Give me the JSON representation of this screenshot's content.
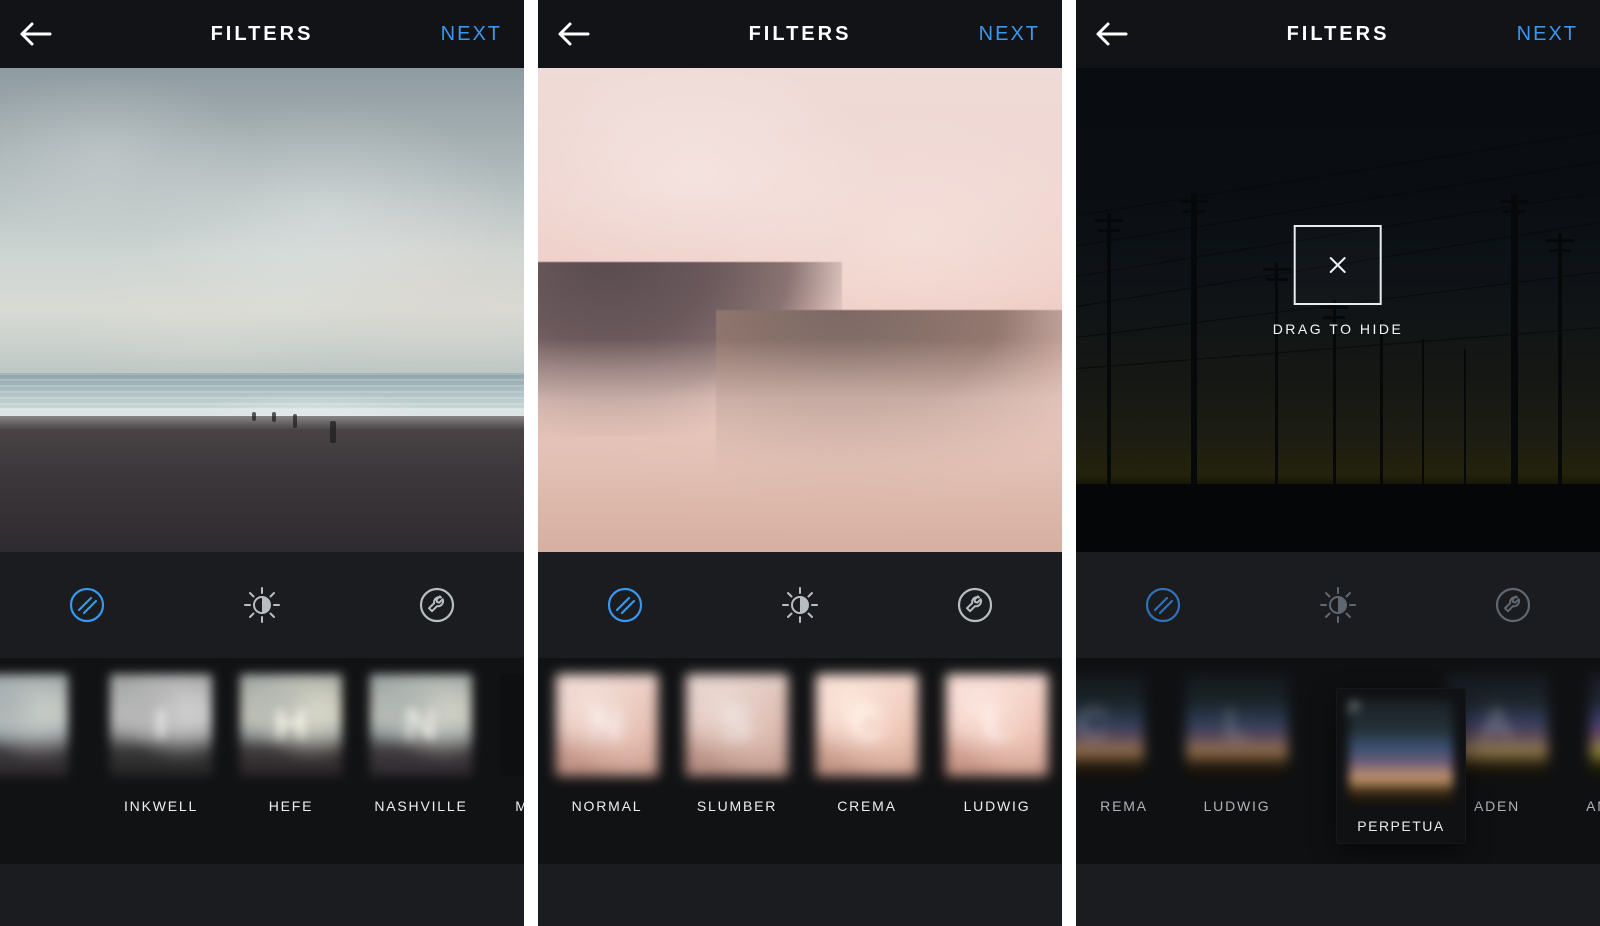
{
  "colors": {
    "accent": "#3897f0",
    "bg": "#1a1c1f"
  },
  "header": {
    "title": "FILTERS",
    "next": "NEXT"
  },
  "screens": {
    "s1": {
      "filters": [
        {
          "letter": "I",
          "label": "INKWELL"
        },
        {
          "letter": "H",
          "label": "HEFE"
        },
        {
          "letter": "N",
          "label": "NASHVILLE"
        },
        {
          "letter": "",
          "label": "MANAGE",
          "manage": true
        }
      ]
    },
    "s2": {
      "filters": [
        {
          "letter": "N",
          "label": "NORMAL"
        },
        {
          "letter": "S",
          "label": "SLUMBER"
        },
        {
          "letter": "C",
          "label": "CREMA"
        },
        {
          "letter": "L",
          "label": "LUDWIG"
        }
      ]
    },
    "s3": {
      "dragHint": "DRAG TO HIDE",
      "raised": {
        "letter": "P",
        "label": "PERPETUA"
      },
      "filters_left": [
        {
          "letter": "C",
          "label": "REMA"
        },
        {
          "letter": "L",
          "label": "LUDWIG"
        }
      ],
      "filters_right": [
        {
          "letter": "A",
          "label": "ADEN"
        },
        {
          "letter": "A",
          "label": "AMAR"
        }
      ]
    }
  }
}
